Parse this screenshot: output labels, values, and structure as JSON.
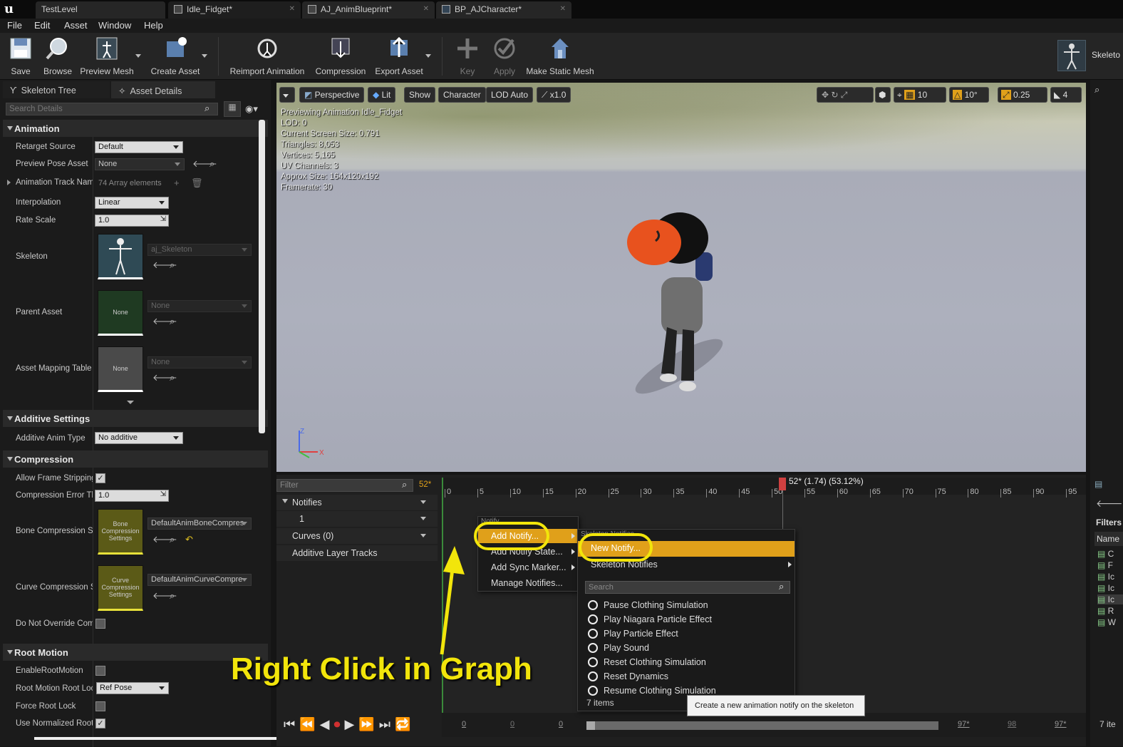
{
  "tabs": [
    {
      "label": "TestLevel"
    },
    {
      "label": "Idle_Fidget*"
    },
    {
      "label": "AJ_AnimBlueprint*"
    },
    {
      "label": "BP_AJCharacter*"
    }
  ],
  "menu": [
    "File",
    "Edit",
    "Asset",
    "Window",
    "Help"
  ],
  "toolbar": {
    "save": "Save",
    "browse": "Browse",
    "preview_mesh": "Preview Mesh",
    "create_asset": "Create Asset",
    "reimport": "Reimport Animation",
    "compression": "Compression",
    "export_asset": "Export Asset",
    "key": "Key",
    "apply": "Apply",
    "make_static_mesh": "Make Static Mesh",
    "skeleton": "Skeleto"
  },
  "left_panel": {
    "tab_skeleton_tree": "Skeleton Tree",
    "tab_asset_details": "Asset Details",
    "search_placeholder": "Search Details",
    "sections": {
      "animation": "Animation",
      "additive": "Additive Settings",
      "compression": "Compression",
      "root_motion": "Root Motion"
    },
    "props": {
      "retarget_source": {
        "label": "Retarget Source",
        "value": "Default"
      },
      "preview_pose": {
        "label": "Preview Pose Asset",
        "value": "None"
      },
      "track_names": {
        "label": "Animation Track Nam",
        "value": "74 Array elements"
      },
      "interpolation": {
        "label": "Interpolation",
        "value": "Linear"
      },
      "rate_scale": {
        "label": "Rate Scale",
        "value": "1.0"
      },
      "skeleton": {
        "label": "Skeleton",
        "value": "aj_Skeleton"
      },
      "parent_asset": {
        "label": "Parent Asset",
        "value": "None",
        "thumb": "None"
      },
      "mapping_table": {
        "label": "Asset Mapping Table",
        "value": "None",
        "thumb": "None"
      },
      "additive_type": {
        "label": "Additive Anim Type",
        "value": "No additive"
      },
      "frame_stripping": {
        "label": "Allow Frame Stripping"
      },
      "compression_error": {
        "label": "Compression Error Th",
        "value": "1.0"
      },
      "bone_compression": {
        "label": "Bone Compression Se",
        "value": "DefaultAnimBoneCompres",
        "thumb": "Bone Compression Settings"
      },
      "curve_compression": {
        "label": "Curve Compression S",
        "value": "DefaultAnimCurveCompre",
        "thumb": "Curve Compression Settings"
      },
      "do_not_override": {
        "label": "Do Not Override Com"
      },
      "enable_root_motion": {
        "label": "EnableRootMotion"
      },
      "root_motion_lock": {
        "label": "Root Motion Root Loc",
        "value": "Ref Pose"
      },
      "force_root_lock": {
        "label": "Force Root Lock"
      },
      "use_normalized": {
        "label": "Use Normalized Root"
      }
    }
  },
  "viewport": {
    "buttons": {
      "perspective": "Perspective",
      "lit": "Lit",
      "show": "Show",
      "character": "Character",
      "lod": "LOD Auto",
      "speed": "x1.0"
    },
    "right_controls": {
      "grid": "10",
      "angle": "10°",
      "scale": "0.25",
      "camera": "4"
    },
    "info": [
      "Previewing Animation Idle_Fidget",
      "LOD: 0",
      "Current Screen Size: 0.791",
      "Triangles: 8,053",
      "Vertices: 5,165",
      "UV Channels: 3",
      "Approx Size: 164x120x192",
      "Framerate: 30"
    ]
  },
  "timeline": {
    "filter_placeholder": "Filter",
    "frame": "52*",
    "tracks": {
      "notifies": "Notifies",
      "track1": "1",
      "curves": "Curves  (0)",
      "additive": "Additive Layer Tracks"
    },
    "ruler": [
      "0",
      "5",
      "10",
      "15",
      "20",
      "25",
      "30",
      "35",
      "40",
      "45",
      "50",
      "55",
      "60",
      "65",
      "70",
      "75",
      "80",
      "85",
      "90",
      "95"
    ],
    "scrub_label": "52* (1.74) (53.12%)",
    "bottom": {
      "a": "0",
      "b": "0",
      "c": "0",
      "d": "97*",
      "e": "98",
      "f": "97*"
    }
  },
  "context_menu": {
    "header": "Notify",
    "items": [
      "Add Notify...",
      "Add Notify State...",
      "Add Sync Marker...",
      "Manage Notifies..."
    ]
  },
  "submenu": {
    "header": "Skeleton Notifies",
    "new_notify": "New Notify...",
    "skeleton_notifies": "Skeleton Notifies",
    "search_placeholder": "Search",
    "items": [
      "Pause Clothing Simulation",
      "Play Niagara Particle Effect",
      "Play Particle Effect",
      "Play Sound",
      "Reset Clothing Simulation",
      "Reset Dynamics",
      "Resume Clothing Simulation"
    ],
    "count": "7 items",
    "tooltip": "Create a new animation notify on the skeleton"
  },
  "annotation": "Right Click in Graph",
  "right_panel": {
    "filters": "Filters",
    "name": "Name",
    "count": "7 ite",
    "list": [
      "C",
      "F",
      "Ic",
      "Ic",
      "Ic",
      "R",
      "W"
    ]
  },
  "colors": {
    "accent": "#e0a01a",
    "annotation": "#f2e50b"
  }
}
